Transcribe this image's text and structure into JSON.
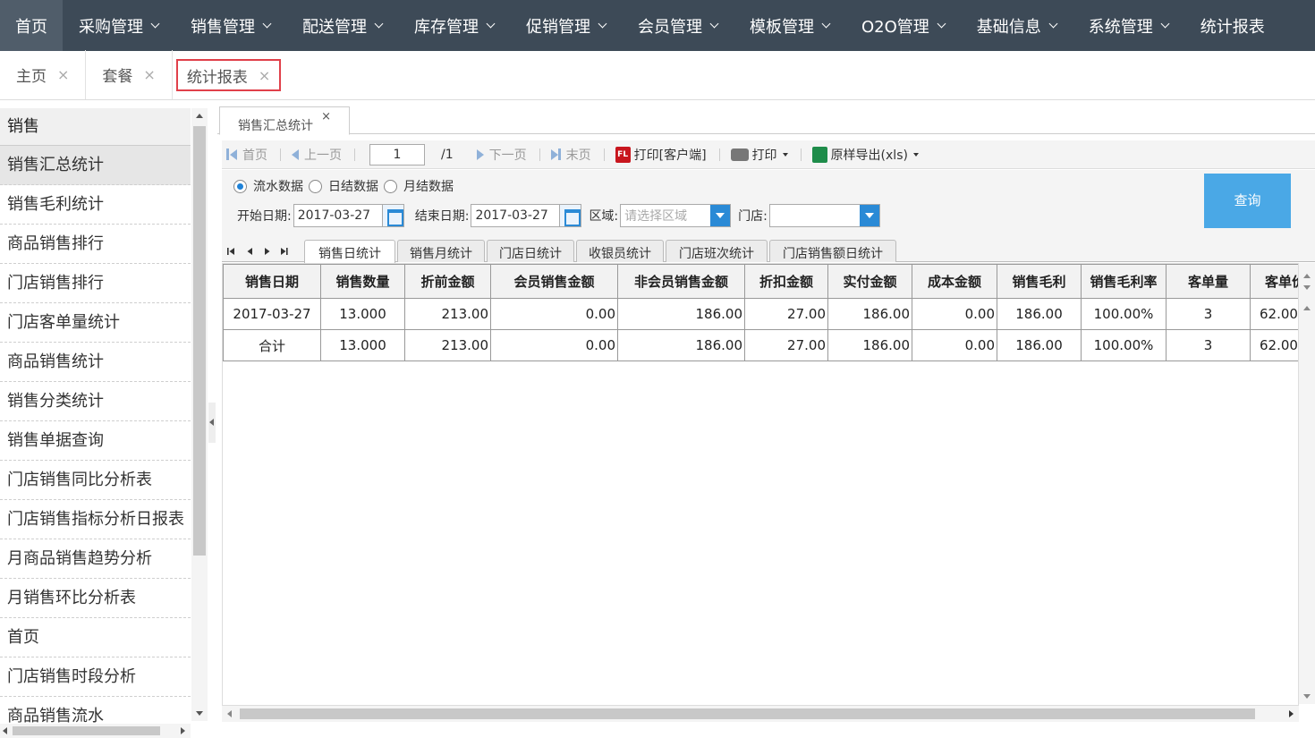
{
  "topnav": {
    "items": [
      {
        "label": "首页"
      },
      {
        "label": "采购管理"
      },
      {
        "label": "销售管理"
      },
      {
        "label": "配送管理"
      },
      {
        "label": "库存管理"
      },
      {
        "label": "促销管理"
      },
      {
        "label": "会员管理"
      },
      {
        "label": "模板管理"
      },
      {
        "label": "O2O管理"
      },
      {
        "label": "基础信息"
      },
      {
        "label": "系统管理"
      },
      {
        "label": "统计报表"
      }
    ]
  },
  "pagetabs": [
    {
      "label": "主页",
      "close": "×"
    },
    {
      "label": "套餐",
      "close": "×"
    },
    {
      "label": "统计报表",
      "close": "×"
    }
  ],
  "sidebar": {
    "header": "销售",
    "items": [
      "销售汇总统计",
      "销售毛利统计",
      "商品销售排行",
      "门店销售排行",
      "门店客单量统计",
      "商品销售统计",
      "销售分类统计",
      "销售单据查询",
      "门店销售同比分析表",
      "门店销售指标分析日报表",
      "月商品销售趋势分析",
      "月销售环比分析表",
      "首页",
      "门店销售时段分析",
      "商品销售流水"
    ]
  },
  "inner_tab": {
    "label": "销售汇总统计",
    "close": "×"
  },
  "toolbar": {
    "first": "首页",
    "prev": "上一页",
    "page_value": "1",
    "page_total": "/1",
    "next": "下一页",
    "last": "末页",
    "print_client": "打印[客户端]",
    "print": "打印",
    "export": "原样导出(xls)",
    "pdf_icon_text": "FL"
  },
  "filters": {
    "radios": [
      {
        "label": "流水数据",
        "checked": true
      },
      {
        "label": "日结数据",
        "checked": false
      },
      {
        "label": "月结数据",
        "checked": false
      }
    ],
    "start_label": "开始日期:",
    "start_value": "2017-03-27",
    "end_label": "结束日期:",
    "end_value": "2017-03-27",
    "region_label": "区域:",
    "region_placeholder": "请选择区域",
    "store_label": "门店:",
    "store_value": "",
    "query_button": "查询"
  },
  "subtabs": [
    "销售日统计",
    "销售月统计",
    "门店日统计",
    "收银员统计",
    "门店班次统计",
    "门店销售额日统计"
  ],
  "table": {
    "headers": [
      "销售日期",
      "销售数量",
      "折前金额",
      "会员销售金额",
      "非会员销售金额",
      "折扣金额",
      "实付金额",
      "成本金额",
      "销售毛利",
      "销售毛利率",
      "客单量",
      "客单价"
    ],
    "rows": [
      [
        "2017-03-27",
        "13.000",
        "213.00",
        "0.00",
        "186.00",
        "27.00",
        "186.00",
        "0.00",
        "186.00",
        "100.00%",
        "3",
        "62.00"
      ],
      [
        "合计",
        "13.000",
        "213.00",
        "0.00",
        "186.00",
        "27.00",
        "186.00",
        "0.00",
        "186.00",
        "100.00%",
        "3",
        "62.00"
      ]
    ]
  },
  "colors": {
    "nav_bg": "#3d4a57",
    "active_tab_border": "#e0404a",
    "query_button": "#4aa8e6",
    "accent": "#2a8ad6"
  }
}
